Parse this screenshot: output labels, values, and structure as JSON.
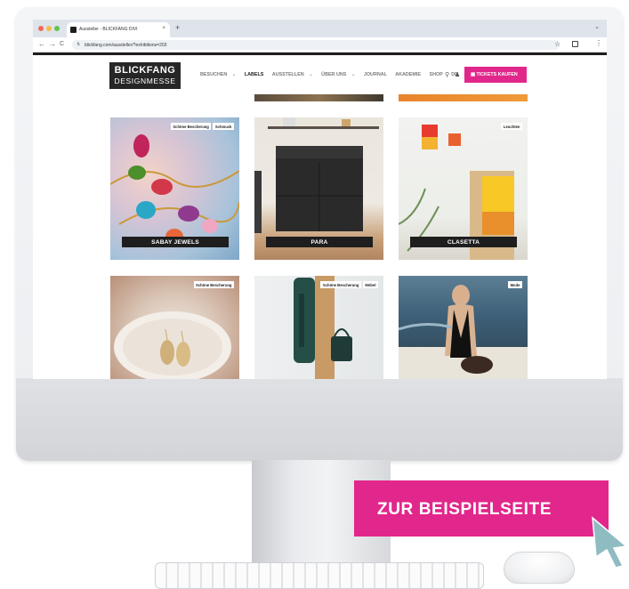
{
  "browser": {
    "tab_title": "Aussteller - BLICKFANG DIVI",
    "tab_close": "×",
    "new_tab": "+",
    "url": "blickfang.com/aussteller/?exhibitions=203",
    "nav_back": "←",
    "nav_forward": "→",
    "nav_reload": "C",
    "star": "☆",
    "menu": "⋮",
    "win_chevron": "⌄"
  },
  "site": {
    "logo_line1": "BLICKFANG",
    "logo_line2": "DESIGNMESSE",
    "nav": [
      {
        "label": "BESUCHEN",
        "chevron": "⌄"
      },
      {
        "label": "LABELS"
      },
      {
        "label": "AUSSTELLEN",
        "chevron": "⌄"
      },
      {
        "label": "ÜBER UNS",
        "chevron": "⌄"
      },
      {
        "label": "JOURNAL"
      },
      {
        "label": "AKADEMIE"
      },
      {
        "label": "SHOP"
      },
      {
        "label": "DE",
        "chevron": "⌄"
      }
    ],
    "ticket_button": "TICKETS KAUFEN",
    "accent_color": "#e1278b"
  },
  "cards": [
    {
      "name": "SABAY JEWELS",
      "tags": [
        "Schöne Bescherung",
        "Schmuck"
      ]
    },
    {
      "name": "PARA",
      "tags": []
    },
    {
      "name": "CLASETTA",
      "tags": [
        "Leuchten"
      ]
    },
    {
      "name": "",
      "tags": [
        "Schöne Bescherung"
      ]
    },
    {
      "name": "",
      "tags": [
        "Schöne Bescherung",
        "Möbel"
      ]
    },
    {
      "name": "",
      "tags": [
        "Mode"
      ]
    }
  ],
  "cta": {
    "label": "ZUR BEISPIELSEITE"
  }
}
